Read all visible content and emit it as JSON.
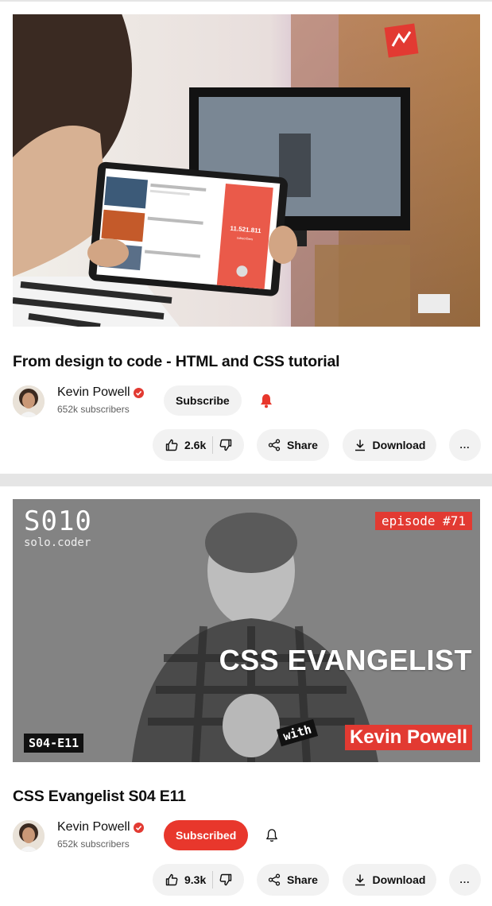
{
  "videos": [
    {
      "title": "From design to code - HTML and CSS tutorial",
      "channel": "Kevin Powell",
      "subscribers": "652k subscribers",
      "subscribe_label": "Subscribe",
      "subscribed": false,
      "likes": "2.6k",
      "share_label": "Share",
      "download_label": "Download",
      "more_label": "...",
      "thumbnail": {
        "tablet_counter": "11.521.811",
        "tablet_counter_caption": "subscribers"
      }
    },
    {
      "title": "CSS Evangelist S04 E11",
      "channel": "Kevin Powell",
      "subscribers": "652k subscribers",
      "subscribe_label": "Subscribed",
      "subscribed": true,
      "likes": "9.3k",
      "share_label": "Share",
      "download_label": "Download",
      "more_label": "...",
      "thumbnail": {
        "logo": "S010",
        "logo_sub": "solo.coder",
        "episode": "episode #71",
        "headline": "CSS EVANGELIST",
        "season": "S04-E11",
        "with": "with",
        "guest": "Kevin Powell"
      }
    }
  ],
  "colors": {
    "accent_red": "#e8372c",
    "pill_bg": "#f2f2f2",
    "divider": "#e5e5e5"
  },
  "icons": [
    "thumbs-up-icon",
    "thumbs-down-icon",
    "share-icon",
    "download-icon",
    "bell-icon",
    "verified-icon"
  ]
}
